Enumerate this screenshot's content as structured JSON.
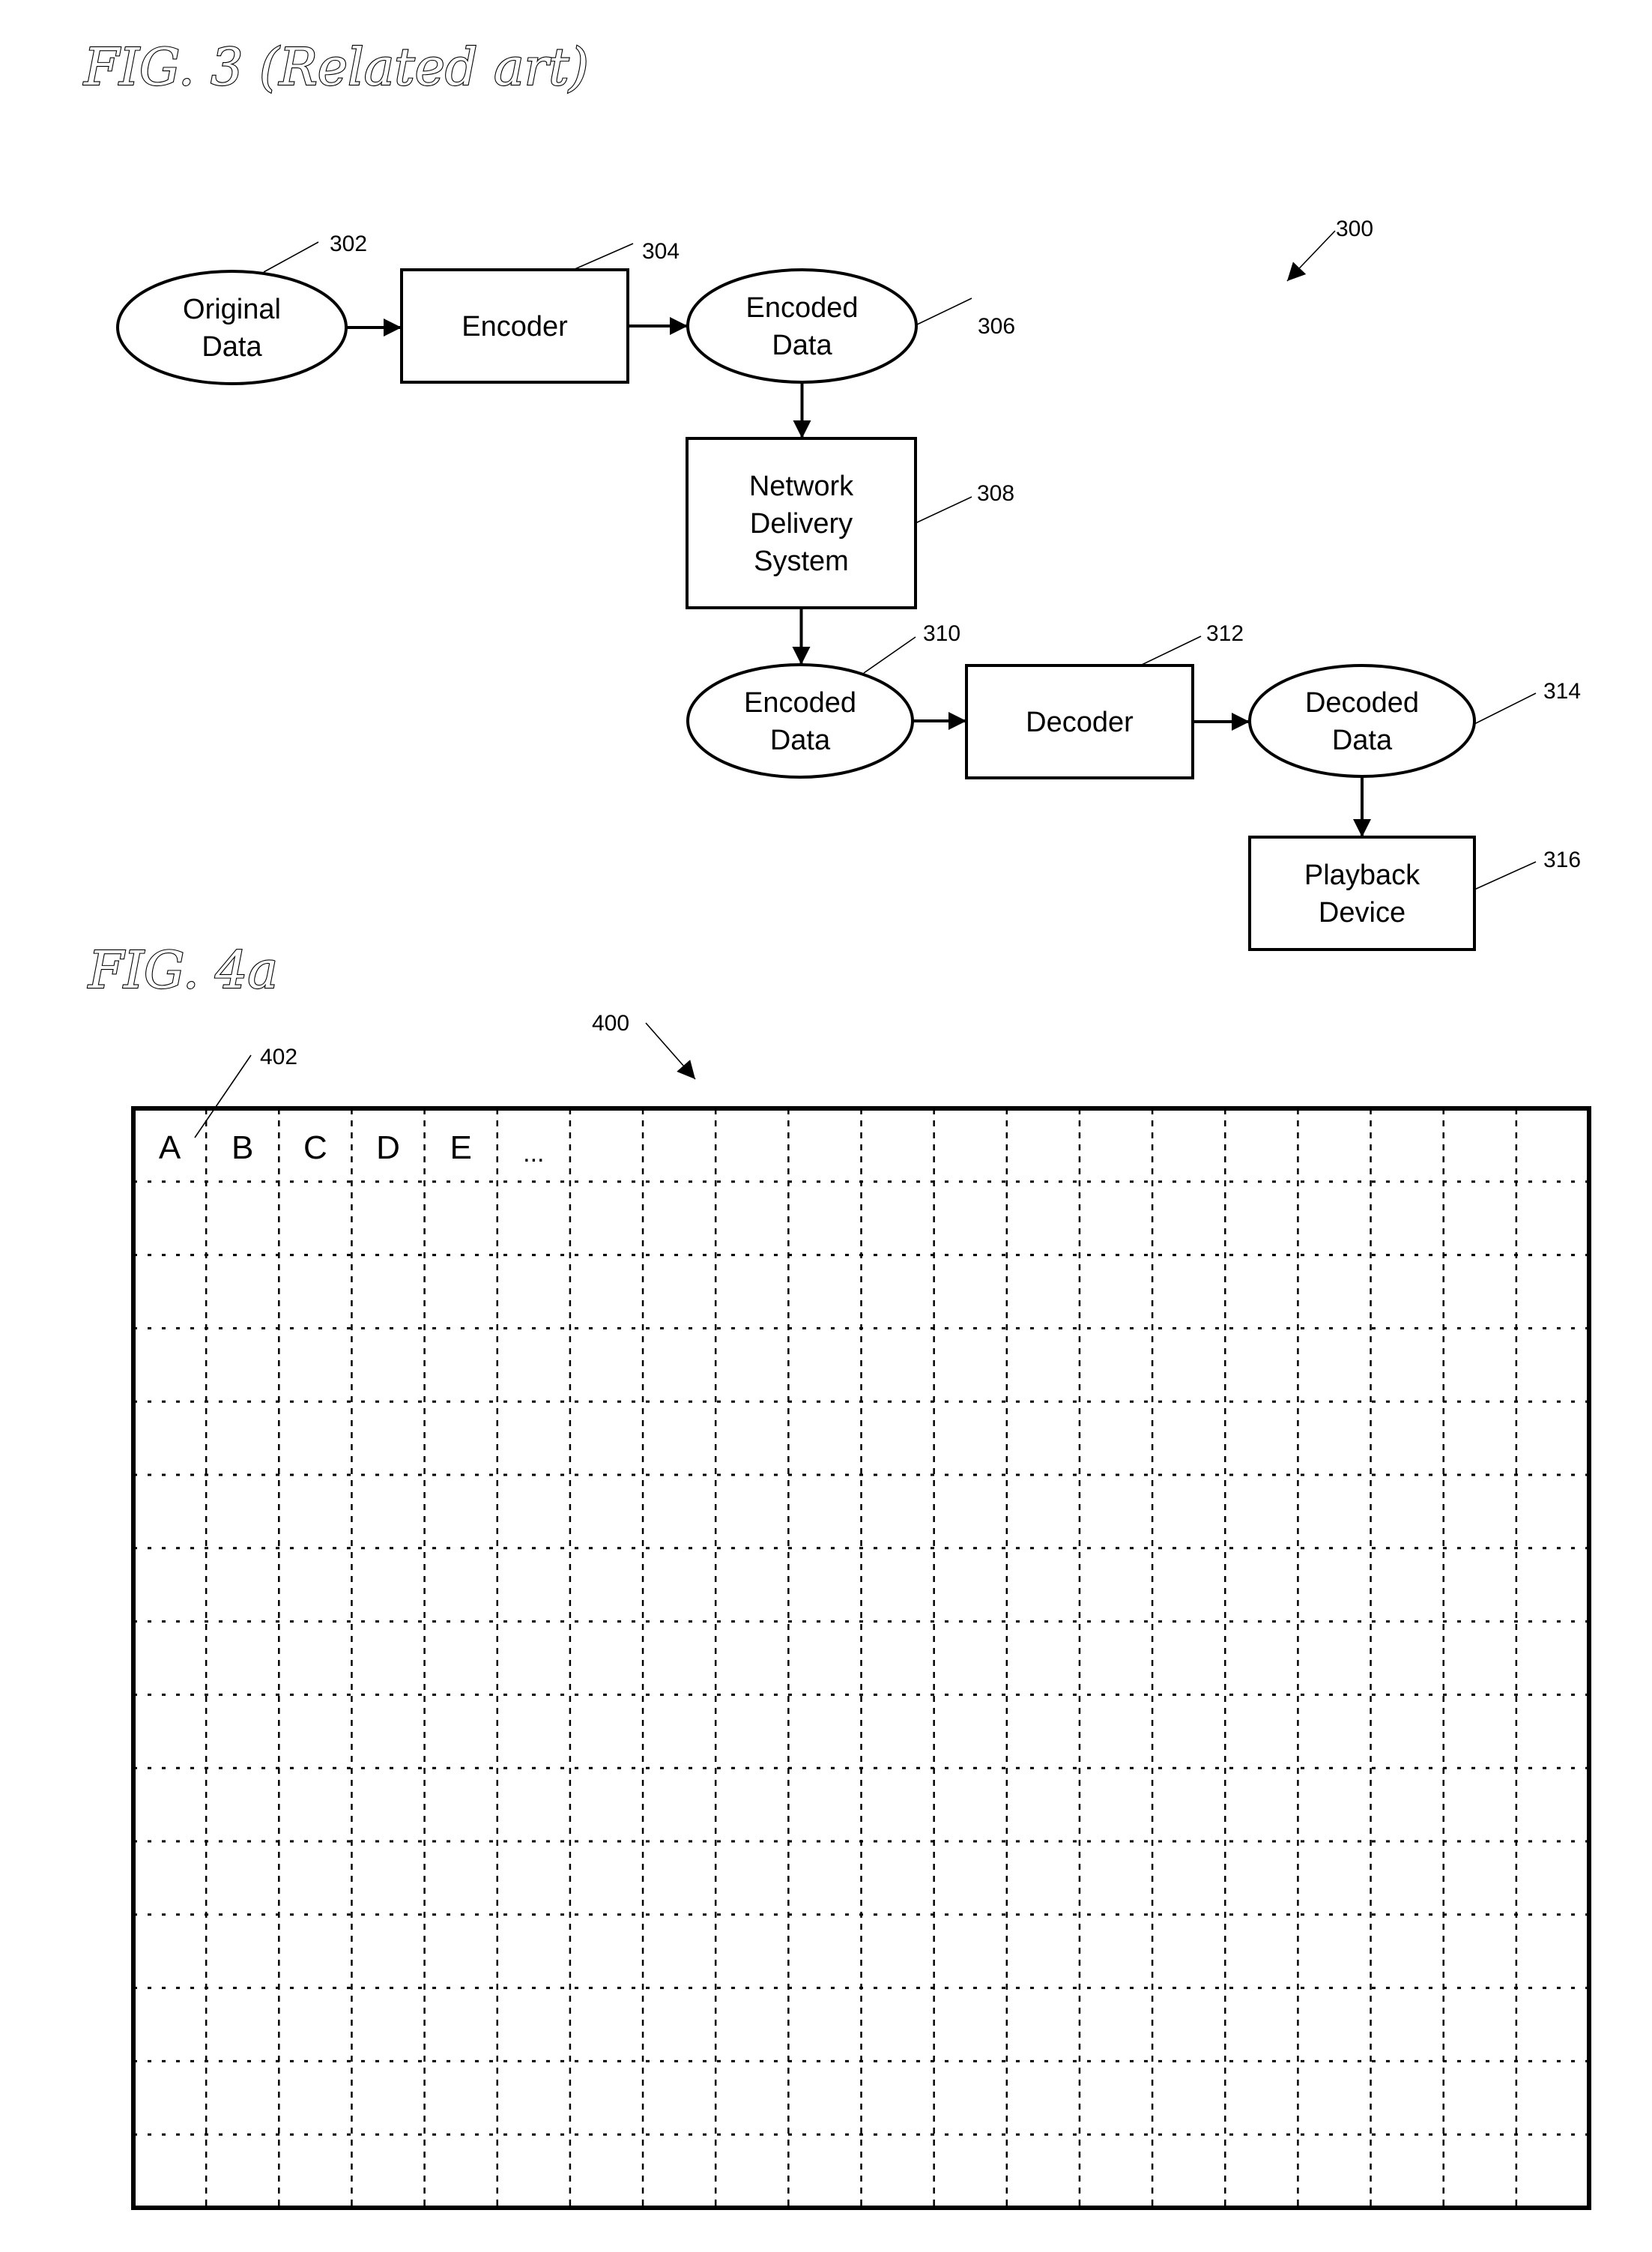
{
  "figures": [
    {
      "id": "fig3",
      "title": "FIG. 3 (Related art)",
      "reference": "300",
      "nodes": [
        {
          "ref": "302",
          "shape": "ellipse",
          "lines": [
            "Original",
            "Data"
          ]
        },
        {
          "ref": "304",
          "shape": "rect",
          "lines": [
            "Encoder"
          ]
        },
        {
          "ref": "306",
          "shape": "ellipse",
          "lines": [
            "Encoded",
            "Data"
          ]
        },
        {
          "ref": "308",
          "shape": "rect",
          "lines": [
            "Network",
            "Delivery",
            "System"
          ]
        },
        {
          "ref": "310",
          "shape": "ellipse",
          "lines": [
            "Encoded",
            "Data"
          ]
        },
        {
          "ref": "312",
          "shape": "rect",
          "lines": [
            "Decoder"
          ]
        },
        {
          "ref": "314",
          "shape": "ellipse",
          "lines": [
            "Decoded",
            "Data"
          ]
        },
        {
          "ref": "316",
          "shape": "rect",
          "lines": [
            "Playback",
            "Device"
          ]
        }
      ],
      "edges": [
        {
          "from": "302",
          "to": "304"
        },
        {
          "from": "304",
          "to": "306"
        },
        {
          "from": "306",
          "to": "308"
        },
        {
          "from": "308",
          "to": "310"
        },
        {
          "from": "310",
          "to": "312"
        },
        {
          "from": "312",
          "to": "314"
        },
        {
          "from": "314",
          "to": "316"
        }
      ]
    },
    {
      "id": "fig4a",
      "title": "FIG. 4a",
      "reference": "400",
      "grid": {
        "columns": 20,
        "rows": 15,
        "cell_reference": "402",
        "first_row_labels": [
          "A",
          "B",
          "C",
          "D",
          "E",
          "..."
        ]
      }
    }
  ]
}
